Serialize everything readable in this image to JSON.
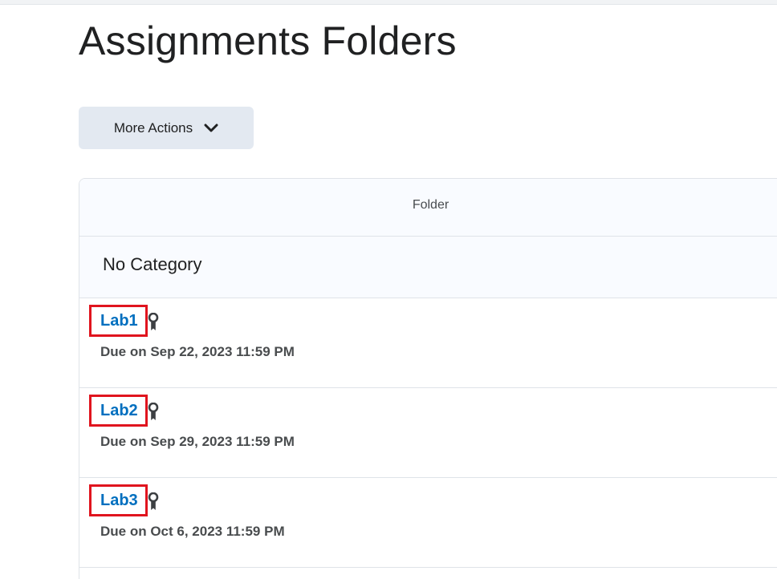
{
  "page": {
    "title": "Assignments Folders"
  },
  "toolbar": {
    "more_actions_label": "More Actions",
    "more_actions_icon": "chevron-down-icon"
  },
  "table": {
    "column_header": "Folder",
    "category": "No Category",
    "items": [
      {
        "name": "Lab1",
        "due": "Due on Sep 22, 2023 11:59 PM",
        "icon": "award-ribbon-icon"
      },
      {
        "name": "Lab2",
        "due": "Due on Sep 29, 2023 11:59 PM",
        "icon": "award-ribbon-icon"
      },
      {
        "name": "Lab3",
        "due": "Due on Oct 6, 2023 11:59 PM",
        "icon": "award-ribbon-icon"
      }
    ]
  },
  "colors": {
    "link": "#006fbf",
    "highlight_border": "#e0141e",
    "button_bg": "#e3e9f1"
  }
}
